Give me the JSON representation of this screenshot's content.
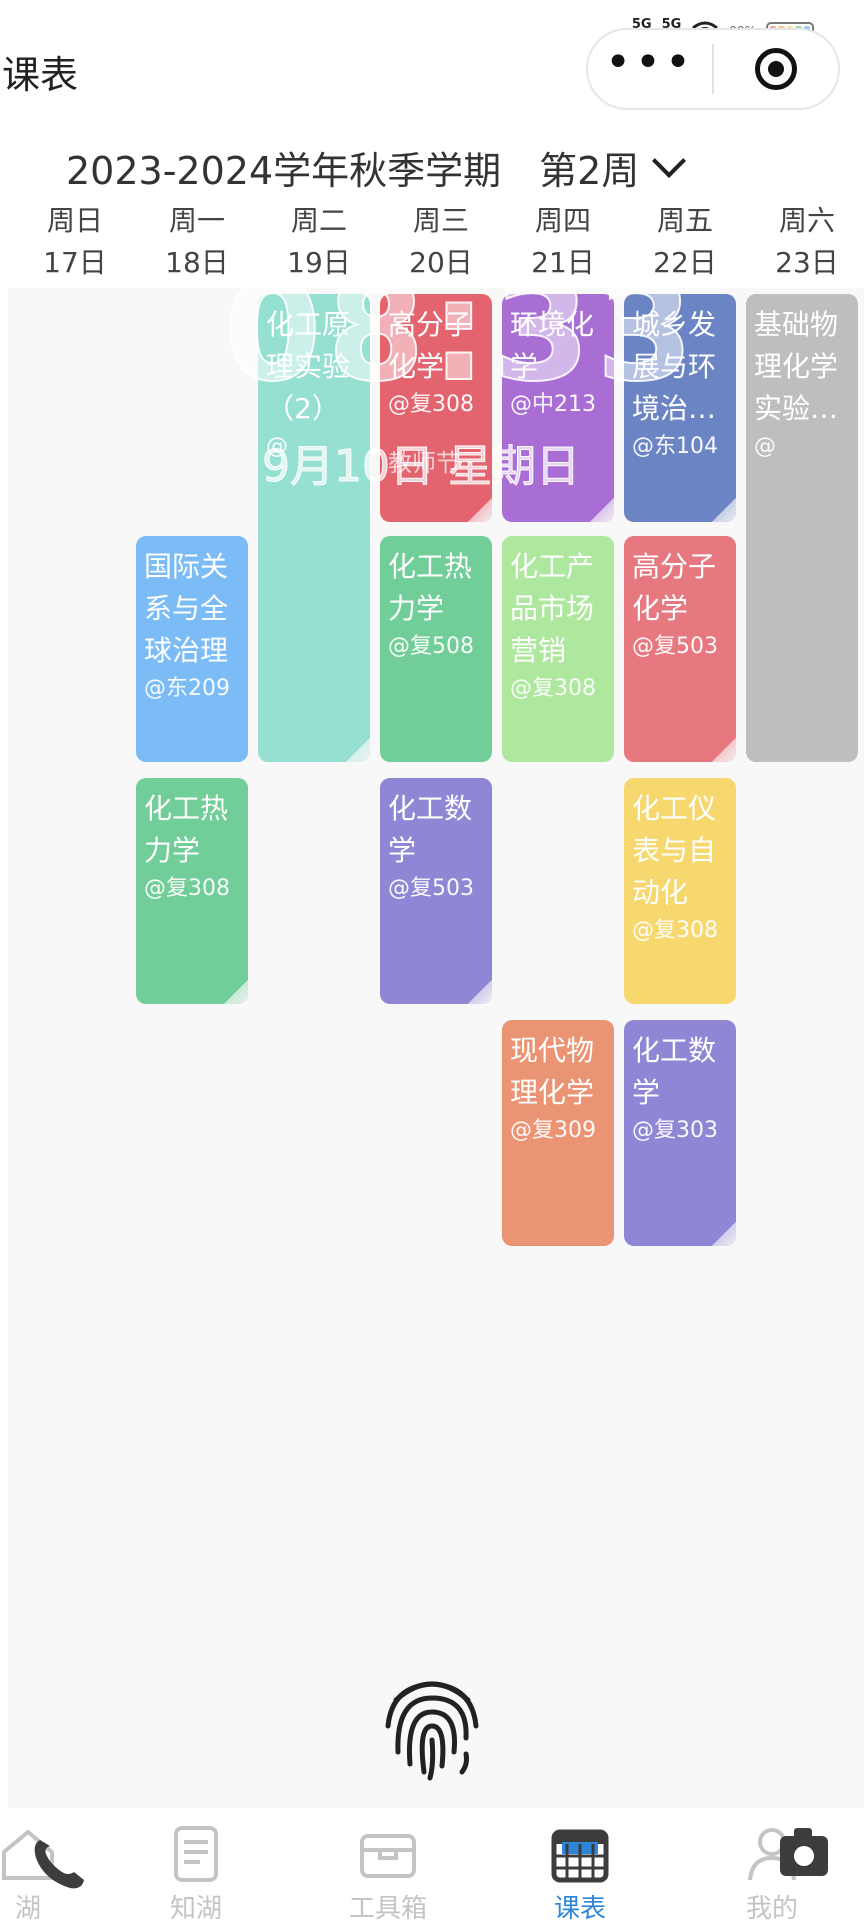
{
  "status_bar": {
    "network1": "5G",
    "network2": "5G",
    "battery_text": "99%",
    "battery_colors": [
      "#f4a3a3",
      "#f6c89a",
      "#f3e59a",
      "#a5dcb6",
      "#9ec8ef"
    ]
  },
  "header": {
    "title": "课表"
  },
  "capsule": {
    "more_label": "•••",
    "close_icon": "target-circle-icon"
  },
  "term": {
    "semester": "2023-2024学年秋季学期",
    "week": "第2周"
  },
  "days": [
    {
      "weekday": "周日",
      "date": "17日"
    },
    {
      "weekday": "周一",
      "date": "18日"
    },
    {
      "weekday": "周二",
      "date": "19日"
    },
    {
      "weekday": "周三",
      "date": "20日"
    },
    {
      "weekday": "周四",
      "date": "21日"
    },
    {
      "weekday": "周五",
      "date": "22日"
    },
    {
      "weekday": "周六",
      "date": "23日"
    }
  ],
  "courses": [
    {
      "name": "化工原理实验（2）",
      "room": "@",
      "color": "#96e0d2"
    },
    {
      "name": "高分子化学",
      "room": "@复308",
      "color": "#e3636f",
      "extra": "教师节"
    },
    {
      "name": "环境化学",
      "room": "@中213",
      "color": "#a86ed4"
    },
    {
      "name": "城乡发展与环境治…",
      "room": "@东104",
      "color": "#6a84c4"
    },
    {
      "name": "基础物理化学实验…",
      "room": "@",
      "color": "#bebebe"
    },
    {
      "name": "国际关系与全球治理",
      "room": "@东209",
      "color": "#7bbcf7"
    },
    {
      "name": "化工热力学",
      "room": "@复508",
      "color": "#72ce98"
    },
    {
      "name": "化工产品市场营销",
      "room": "@复308",
      "color": "#ade89e"
    },
    {
      "name": "高分子化学",
      "room": "@复503",
      "color": "#e77880"
    },
    {
      "name": "化工热力学",
      "room": "@复308",
      "color": "#72ce98"
    },
    {
      "name": "化工数学",
      "room": "@复503",
      "color": "#8f86d6"
    },
    {
      "name": "化工仪表与自动化",
      "room": "@复308",
      "color": "#f6d86e"
    },
    {
      "name": "现代物理化学",
      "room": "@复309",
      "color": "#ea9474"
    },
    {
      "name": "化工数学",
      "room": "@复303",
      "color": "#8f86d6"
    }
  ],
  "lock_overlay": {
    "time": "08:33",
    "date": "9月10日 星期日"
  },
  "tabs": [
    {
      "label": "湖",
      "icon": "home-icon",
      "active": false
    },
    {
      "label": "知湖",
      "icon": "document-icon",
      "active": false
    },
    {
      "label": "工具箱",
      "icon": "toolbox-icon",
      "active": false
    },
    {
      "label": "课表",
      "icon": "calendar-icon",
      "active": true
    },
    {
      "label": "我的",
      "icon": "user-icon",
      "active": false
    }
  ],
  "accent_color": "#2f86d8"
}
